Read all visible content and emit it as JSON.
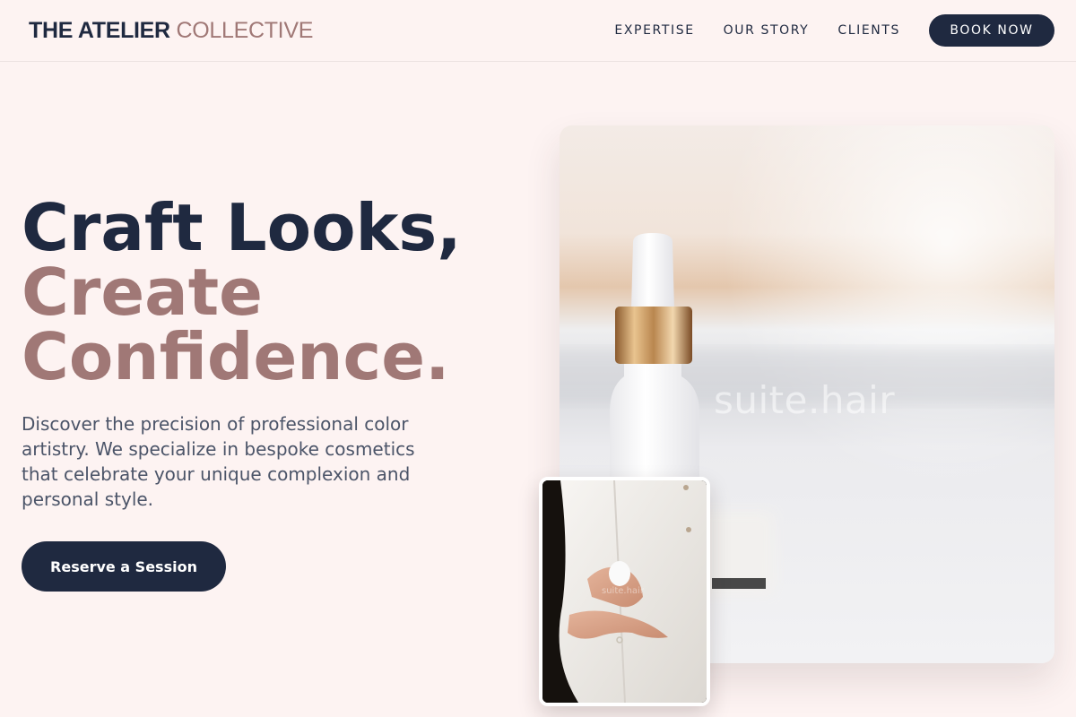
{
  "header": {
    "logo_strong": "THE ATELIER",
    "logo_light": "COLLECTIVE",
    "nav": [
      "EXPERTISE",
      "OUR STORY",
      "CLIENTS"
    ],
    "cta_label": "BOOK NOW"
  },
  "hero": {
    "title_line1": "Craft Looks,",
    "title_line2": "Create",
    "title_line3": "Confidence.",
    "description": "Discover the precision of professional color artistry. We specialize in bespoke cosmetics that celebrate your unique complexion and personal style.",
    "cta_label": "Reserve a Session"
  },
  "images": {
    "main_watermark": "suite.hair",
    "secondary_watermark": "suite.hair"
  },
  "colors": {
    "background": "#fdf3f2",
    "navy": "#1f2940",
    "accent_rose": "#a07876",
    "body_text": "#4b5468"
  }
}
